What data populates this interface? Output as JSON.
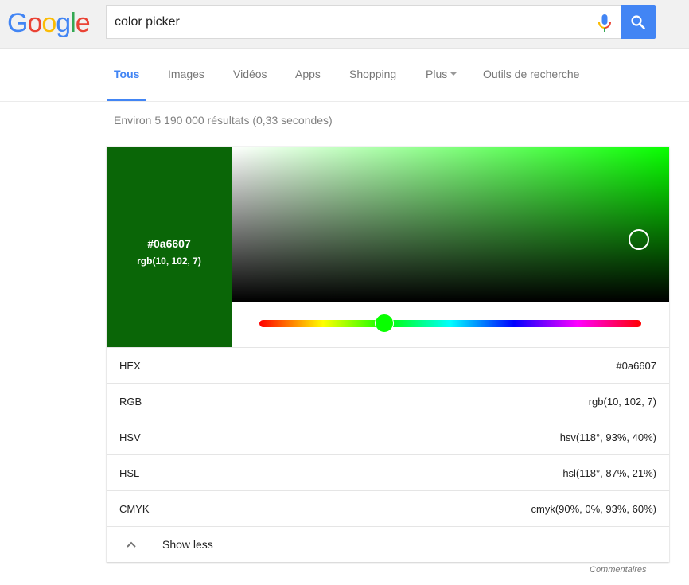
{
  "header": {
    "logo": {
      "letters": [
        "G",
        "o",
        "o",
        "g",
        "l",
        "e"
      ],
      "colors": [
        "#4285f4",
        "#ea4335",
        "#fbbc05",
        "#4285f4",
        "#34a853",
        "#ea4335"
      ]
    },
    "search": {
      "value": "color picker",
      "placeholder": ""
    },
    "mic_icon": "microphone-icon",
    "search_button_icon": "search-icon",
    "accent": "#4285f4"
  },
  "nav": {
    "tabs": [
      {
        "label": "Tous",
        "active": true
      },
      {
        "label": "Images",
        "active": false
      },
      {
        "label": "Vidéos",
        "active": false
      },
      {
        "label": "Apps",
        "active": false
      },
      {
        "label": "Shopping",
        "active": false
      },
      {
        "label": "Plus",
        "active": false,
        "dropdown": true
      },
      {
        "label": "Outils de recherche",
        "active": false
      }
    ]
  },
  "result_stats": "Environ 5 190 000 résultats (0,33 secondes)",
  "color_picker": {
    "selected_color": "#0a6607",
    "swatch_hex": "#0a6607",
    "swatch_rgb": "rgb(10, 102, 7)",
    "hue_degrees": 118,
    "saturation_percent": 93,
    "value_percent": 40,
    "hue_slider_fraction": 0.328,
    "hue_color": "#08ff00",
    "rows": [
      {
        "label": "HEX",
        "value": "#0a6607"
      },
      {
        "label": "RGB",
        "value": "rgb(10, 102, 7)"
      },
      {
        "label": "HSV",
        "value": "hsv(118°, 93%, 40%)"
      },
      {
        "label": "HSL",
        "value": "hsl(118°, 87%, 21%)"
      },
      {
        "label": "CMYK",
        "value": "cmyk(90%, 0%, 93%, 60%)"
      }
    ],
    "show_less_label": "Show less",
    "show_less_icon": "chevron-up-icon"
  },
  "feedback_label": "Commentaires"
}
